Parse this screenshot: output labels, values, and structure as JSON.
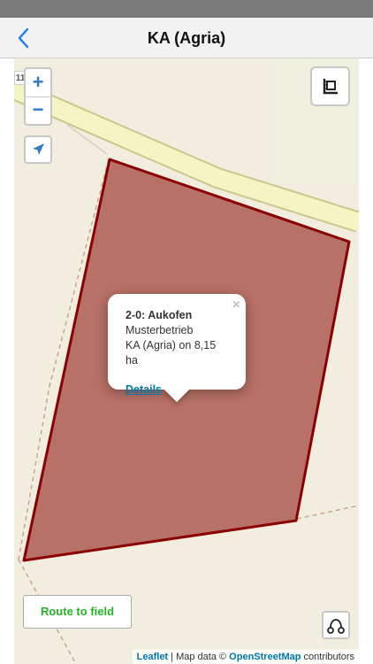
{
  "nav": {
    "title": "KA (Agria)",
    "back_icon": "chevron-left-icon"
  },
  "map": {
    "road_label": "11",
    "zoom_in_label": "+",
    "zoom_out_label": "−",
    "locate_icon": "navigation-arrow-icon",
    "measure_icon": "ruler-square-icon",
    "route_icon": "route-path-icon",
    "route_button_label": "Route to field",
    "field_fill_color": "#b87166",
    "field_border_color": "#8b0000",
    "road_color": "#f4f5c4"
  },
  "popup": {
    "title": "2-0: Aukofen",
    "line1": "Musterbetrieb",
    "line2": "KA (Agria) on 8,15 ha",
    "link": "Details",
    "close": "×"
  },
  "attribution": {
    "leaflet": "Leaflet",
    "sep": " | Map data © ",
    "osm": "OpenStreetMap",
    "suffix": " contributors"
  }
}
